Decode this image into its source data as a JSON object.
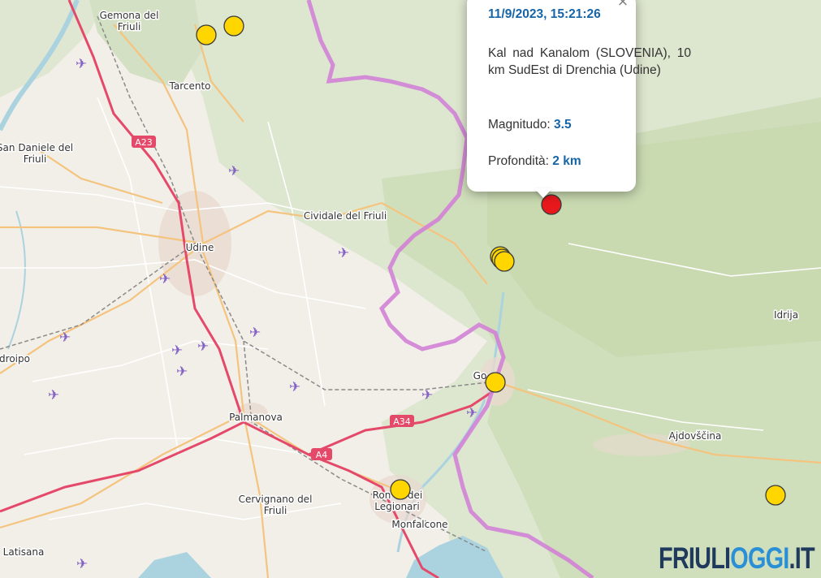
{
  "popup": {
    "datetime": "11/9/2023, 15:21:26",
    "location": "Kal nad Kanalom (SLOVENIA), 10 km SudEst di Drenchia (Udine)",
    "magnitude_label": "Magnitudo:",
    "magnitude_value": "3.5",
    "depth_label": "Profondità:",
    "depth_value": "2 km",
    "close_symbol": "×"
  },
  "places": {
    "gemona": [
      "Gemona del",
      "Friuli"
    ],
    "tarcento": "Tarcento",
    "san_daniele": [
      "San Daniele del",
      "Friuli"
    ],
    "udine": "Udine",
    "cividale": "Cividale del Friuli",
    "idrija": "Idrija",
    "codroipo": "droipo",
    "gorizia": "Go",
    "ajdovscina": "Ajdovščina",
    "palmanova": "Palmanova",
    "cervignano": [
      "Cervignano del",
      "Friuli"
    ],
    "ronchi": [
      "Ron",
      "dei",
      "Legionari"
    ],
    "monfalcone": "Monfalcone",
    "latisana": "Latisana"
  },
  "roads": {
    "a23": "A23",
    "a34": "A34",
    "a4": "A4"
  },
  "logo": {
    "part1": "FRIULI",
    "part2": "OGGI",
    "part3": ".IT"
  },
  "colors": {
    "epicenter": "#e8191d",
    "earthquake": "#ffd600",
    "border": "#d282d6",
    "motorway": "#e5496a"
  },
  "icons": {
    "airfield": "airplane-icon"
  }
}
